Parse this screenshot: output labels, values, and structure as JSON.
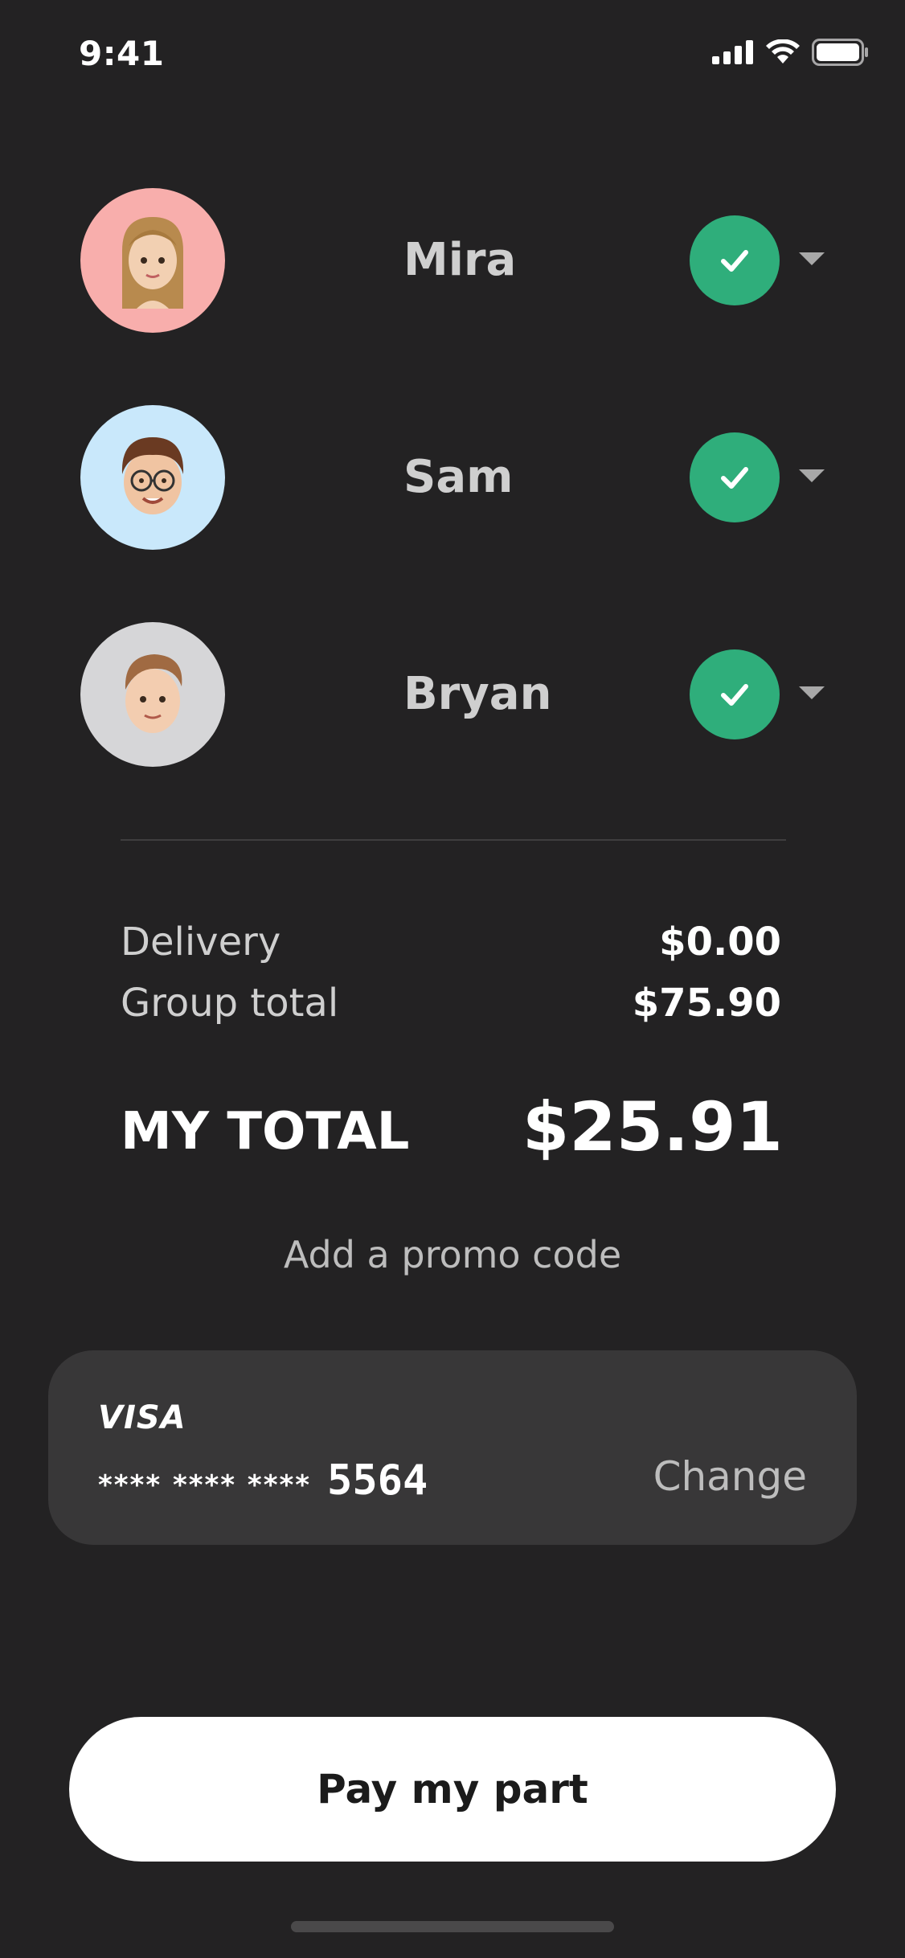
{
  "status_bar": {
    "time": "9:41",
    "signal_icon": "cellular-signal-icon",
    "wifi_icon": "wifi-icon",
    "battery_icon": "battery-icon"
  },
  "members": [
    {
      "name": "Mira",
      "avatar_bg": "#f8aeac",
      "avatar_icon": "memoji-avatar-icon",
      "status_icon": "checkmark-icon"
    },
    {
      "name": "Sam",
      "avatar_bg": "#c9e8fb",
      "avatar_icon": "memoji-avatar-icon",
      "status_icon": "checkmark-icon"
    },
    {
      "name": "Bryan",
      "avatar_bg": "#d6d6d8",
      "avatar_icon": "memoji-avatar-icon",
      "status_icon": "checkmark-icon"
    }
  ],
  "summary": {
    "delivery_label": "Delivery",
    "delivery_value": "$0.00",
    "group_total_label": "Group total",
    "group_total_value": "$75.90",
    "my_total_label": "MY TOTAL",
    "my_total_value": "$25.91"
  },
  "promo": {
    "label": "Add a promo code"
  },
  "payment_card": {
    "brand": "VISA",
    "masked": "**** **** ****",
    "last4": "5564",
    "change_label": "Change"
  },
  "pay_button": {
    "label": "Pay my part"
  },
  "colors": {
    "background": "#232223",
    "accent_green": "#2fae7b",
    "card_panel": "#383738",
    "button": "#ffffff"
  }
}
